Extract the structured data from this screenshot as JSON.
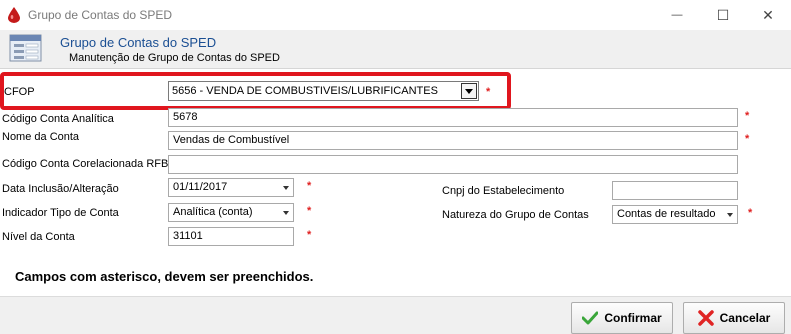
{
  "window": {
    "title": "Grupo de Contas do SPED",
    "minimize_glyph": "—",
    "maximize_glyph": "☐",
    "close_glyph": "✕"
  },
  "header": {
    "title": "Grupo de Contas do SPED",
    "subtitle": "Manutenção de Grupo de Contas do SPED"
  },
  "form": {
    "cfop": {
      "label": "CFOP",
      "value": "5656  - VENDA DE COMBUSTIVEIS/LUBRIFICANTES",
      "required": "*"
    },
    "codigo_conta_analitica": {
      "label": "Código Conta Analítica",
      "value": "5678",
      "required": "*"
    },
    "nome_da_conta": {
      "label": "Nome da Conta",
      "value": "Vendas de Combustível",
      "required": "*"
    },
    "codigo_conta_corelacionada": {
      "label": "Código Conta Corelacionada RFB",
      "value": ""
    },
    "data_inclusao": {
      "label": "Data Inclusão/Alteração",
      "value": "01/11/2017",
      "required": "*"
    },
    "indicador_tipo": {
      "label": "Indicador Tipo de Conta",
      "value": "Analítica (conta)",
      "required": "*"
    },
    "nivel_da_conta": {
      "label": "Nível da Conta",
      "value": "31101",
      "required": "*"
    },
    "cnpj_estabelecimento": {
      "label": "Cnpj do Estabelecimento",
      "value": ""
    },
    "natureza_grupo": {
      "label": "Natureza do Grupo de Contas",
      "value": "Contas de resultado",
      "required": "*"
    }
  },
  "notice": "Campos com asterisco, devem ser preenchidos.",
  "buttons": {
    "confirm": "Confirmar",
    "cancel": "Cancelar"
  },
  "colors": {
    "highlight": "#e0161e",
    "required": "#e02020",
    "header_title": "#1b4f93"
  },
  "icons": {
    "app": "drop-icon",
    "header": "form-icon",
    "confirm": "check-icon",
    "cancel": "x-icon"
  }
}
